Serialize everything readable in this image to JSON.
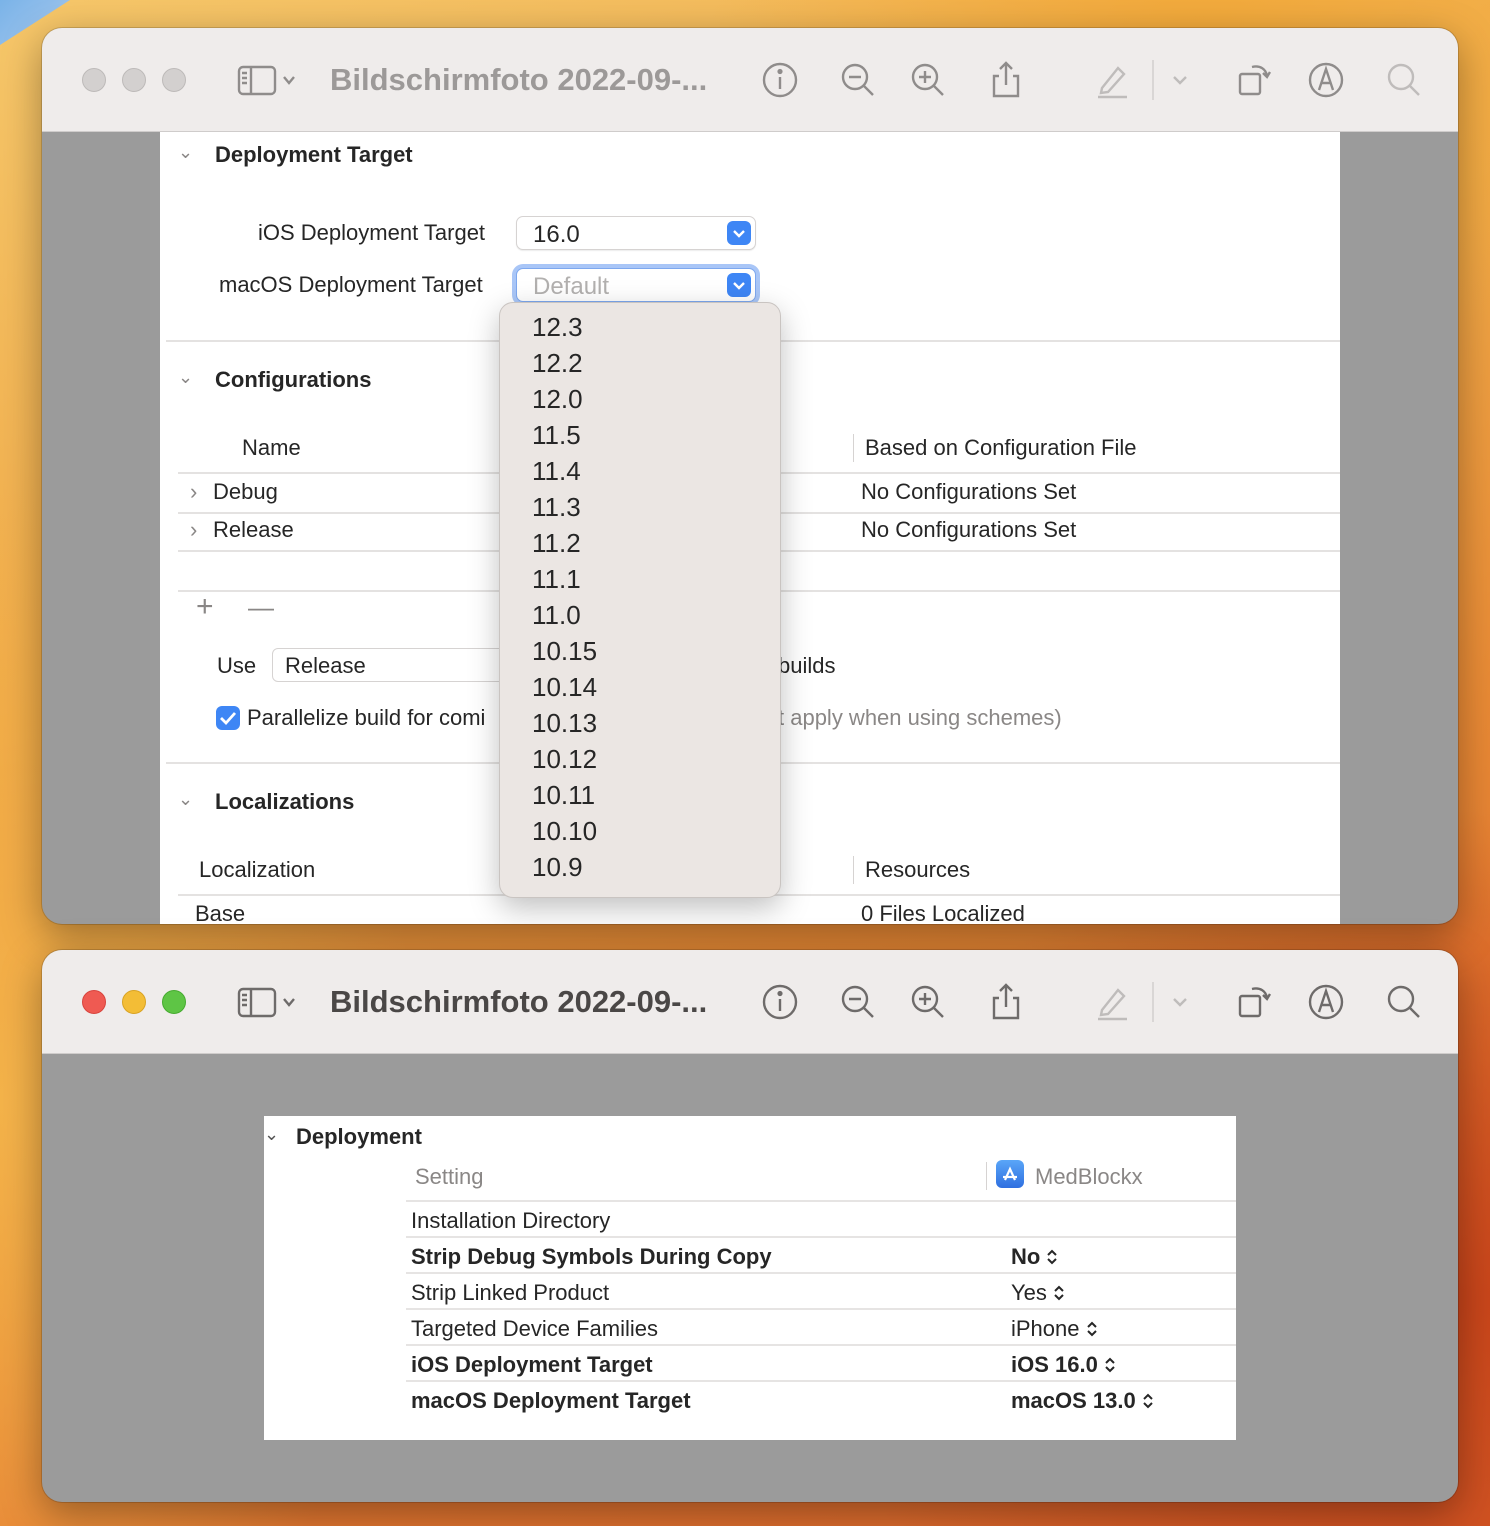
{
  "window_title": "Bildschirmfoto 2022-09-...",
  "colors": {
    "accent": "#3e86f5",
    "close": "#ef5a52",
    "minimize": "#f3bd36",
    "zoom": "#5ec545"
  },
  "toolbar_icons": [
    "sidebar-icon",
    "info-icon",
    "zoom-out-icon",
    "zoom-in-icon",
    "share-icon",
    "markup-pen-icon",
    "rotate-icon",
    "annotate-icon",
    "search-icon"
  ],
  "deployment_target": {
    "header": "Deployment Target",
    "ios_label": "iOS Deployment Target",
    "ios_value": "16.0",
    "macos_label": "macOS Deployment Target",
    "macos_placeholder": "Default",
    "macos_options": [
      "12.3",
      "12.2",
      "12.0",
      "11.5",
      "11.4",
      "11.3",
      "11.2",
      "11.1",
      "11.0",
      "10.15",
      "10.14",
      "10.13",
      "10.12",
      "10.11",
      "10.10",
      "10.9"
    ]
  },
  "configurations": {
    "header": "Configurations",
    "columns": {
      "name": "Name",
      "based_on": "Based on Configuration File"
    },
    "rows": [
      {
        "name": "Debug",
        "based_on": "No Configurations Set"
      },
      {
        "name": "Release",
        "based_on": "No Configurations Set"
      }
    ],
    "add_label": "+",
    "remove_label": "—",
    "use_label": "Use",
    "use_value": "Release",
    "use_suffix": "builds",
    "parallelize_label": "Parallelize build for comi",
    "parallelize_suffix": "t apply when using schemes)",
    "parallelize_checked": true
  },
  "localizations": {
    "header": "Localizations",
    "columns": {
      "localization": "Localization",
      "resources": "Resources"
    },
    "rows": [
      {
        "localization": "Base",
        "resources": "0 Files Localized"
      }
    ]
  },
  "deployment_settings": {
    "header": "Deployment",
    "setting_column": "Setting",
    "target_column": "MedBlockx",
    "rows": [
      {
        "setting": "Installation Directory",
        "value": "",
        "bold": false
      },
      {
        "setting": "Strip Debug Symbols During Copy",
        "value": "No",
        "bold": true
      },
      {
        "setting": "Strip Linked Product",
        "value": "Yes",
        "bold": false
      },
      {
        "setting": "Targeted Device Families",
        "value": "iPhone",
        "bold": false
      },
      {
        "setting": "iOS Deployment Target",
        "value": "iOS 16.0",
        "bold": true
      },
      {
        "setting": "macOS Deployment Target",
        "value": "macOS 13.0",
        "bold": true
      }
    ]
  }
}
